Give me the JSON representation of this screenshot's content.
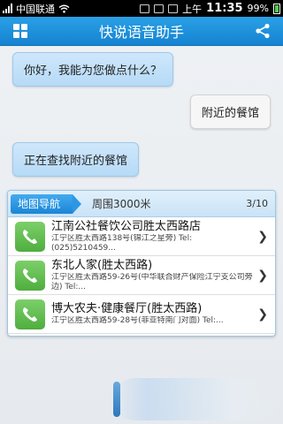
{
  "status": {
    "carrier": "中国联通",
    "ampm": "上午",
    "time": "11:35",
    "battery": "99%"
  },
  "header": {
    "title": "快说语音助手"
  },
  "messages": [
    {
      "side": "left",
      "text": "你好，我能为您做点什么？"
    },
    {
      "side": "right",
      "text": "附近的餐馆"
    },
    {
      "side": "left",
      "text": "正在查找附近的餐馆"
    }
  ],
  "result": {
    "map_nav_label": "地图导航",
    "radius_label": "周围3000米",
    "page_label": "3/10",
    "items": [
      {
        "name": "江南公社餐饮公司胜太西路店",
        "addr": "江宁区胜太西路138号(锦江之星旁) Tel:(025)5210459..."
      },
      {
        "name": "东北人家(胜太西路)",
        "addr": "江宁区胜太西路59-26号(中华联合财产保险江宁支公司旁边) Tel:..."
      },
      {
        "name": "博大农夫·健康餐厅(胜太西路)",
        "addr": "江宁区胜太西路59-28号(菲亚特南门对面) Tel:..."
      }
    ]
  },
  "colors": {
    "header": "#1a8ad8",
    "user_bubble": "#f6f6f6",
    "assistant_bubble": "#c4e1f8",
    "call_button": "#5bb84a"
  }
}
